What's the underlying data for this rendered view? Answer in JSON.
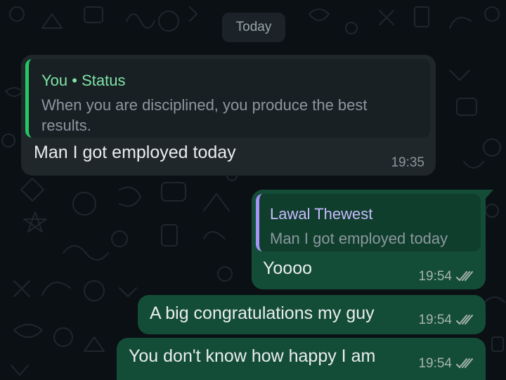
{
  "date_separator": "Today",
  "messages": [
    {
      "direction": "incoming",
      "quote": {
        "author": "You",
        "separator": "•",
        "source": "Status",
        "text": "When you are disciplined, you produce the best results."
      },
      "text": "Man I got employed today",
      "time": "19:35"
    },
    {
      "direction": "outgoing",
      "quote": {
        "author": "Lawal Thewest",
        "text": "Man I got employed today"
      },
      "text": "Yoooo",
      "time": "19:54",
      "status": "read-double-check-icon"
    },
    {
      "direction": "outgoing",
      "text": "A big congratulations my guy",
      "time": "19:54",
      "status": "read-double-check-icon"
    },
    {
      "direction": "outgoing",
      "text": "You don't know how happy I am",
      "time": "19:54",
      "status": "read-double-check-icon"
    }
  ],
  "colors": {
    "background": "#0b1014",
    "incoming_bubble": "#1f272a",
    "outgoing_bubble": "#144d37",
    "status_accent": "#25c865",
    "quote_accent_outgoing": "#a593f5",
    "quote_author_outgoing": "#c7bbff",
    "quote_author_incoming": "#7fe3a6"
  }
}
